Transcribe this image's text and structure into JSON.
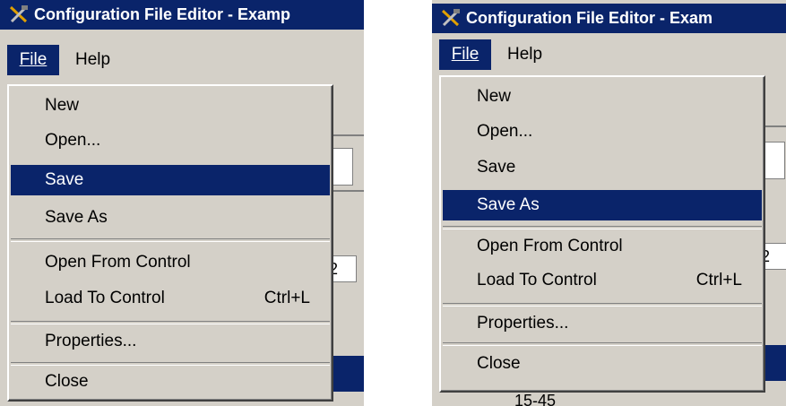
{
  "panels": [
    {
      "title": "Configuration File Editor - Examp",
      "menubar": {
        "file": "File",
        "help": "Help"
      },
      "menu": {
        "new": "New",
        "open": "Open...",
        "save": "Save",
        "save_as": "Save As",
        "open_from_control": "Open From Control",
        "load_to_control": "Load To Control",
        "load_shortcut": "Ctrl+L",
        "properties": "Properties...",
        "close": "Close"
      },
      "highlighted_item": "Save",
      "background_field_value": "2"
    },
    {
      "title": "Configuration File Editor - Exam",
      "menubar": {
        "file": "File",
        "help": "Help"
      },
      "menu": {
        "new": "New",
        "open": "Open...",
        "save": "Save",
        "save_as": "Save As",
        "open_from_control": "Open From Control",
        "load_to_control": "Load To Control",
        "load_shortcut": "Ctrl+L",
        "properties": "Properties...",
        "close": "Close"
      },
      "highlighted_item": "Save As",
      "background_field_value": "2",
      "background_text": "15-45"
    }
  ],
  "colors": {
    "selection": "#0a246a",
    "menu_face": "#d4d0c8",
    "title_bar": "#0a246a"
  },
  "icons": [
    "tools-icon"
  ]
}
